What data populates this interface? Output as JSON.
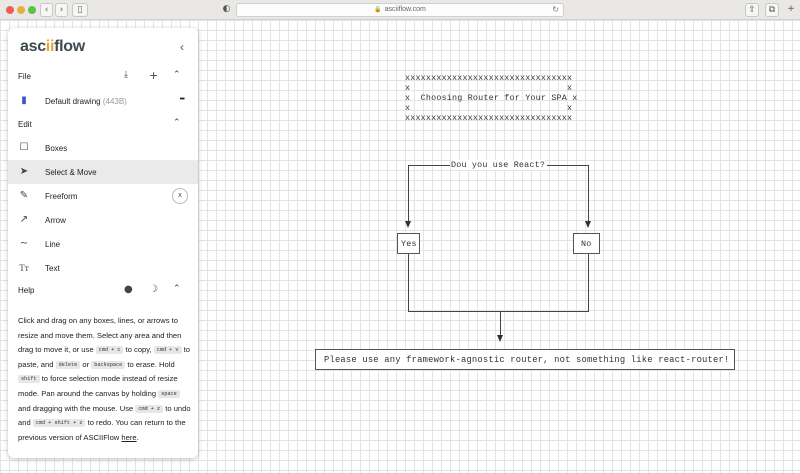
{
  "browser": {
    "url": "asciiflow.com",
    "back_icon": "chevron-left",
    "forward_icon": "chevron-right",
    "sidebar_icon": "sidebar",
    "privacy_icon": "half-circle",
    "reload_icon": "reload",
    "share_icon": "share",
    "tabs_icon": "tabs"
  },
  "sidebar": {
    "logo_prefix": "asc",
    "logo_accent": "ii",
    "logo_suffix": "flow",
    "collapse_icon": "chevron-left",
    "file": {
      "label": "File",
      "drawing_name": "Default drawing",
      "drawing_size": "(443B)",
      "more": "•••"
    },
    "edit": {
      "label": "Edit",
      "tools": [
        {
          "label": "Boxes",
          "icon": "square-icon"
        },
        {
          "label": "Select & Move",
          "icon": "cursor-icon",
          "selected": true
        },
        {
          "label": "Freeform",
          "icon": "pen-icon"
        },
        {
          "label": "Arrow",
          "icon": "arrow-icon"
        },
        {
          "label": "Line",
          "icon": "line-icon"
        },
        {
          "label": "Text",
          "icon": "text-icon"
        }
      ],
      "clear_label": "x",
      "text_icon_glyph": "Tт"
    },
    "help": {
      "label": "Help",
      "t1": "Click and drag on any boxes, lines, or arrows to resize and move them. Select any area and then drag to move it, or use ",
      "k_copy": "cmd + c",
      "t2": " to copy, ",
      "k_paste": "cmd + v",
      "t3": " to paste, and ",
      "k_delete": "delete",
      "t4": " or ",
      "k_backspace": "backspace",
      "t5": " to erase. Hold ",
      "k_shift": "shift",
      "t6": " to force selection mode instead of resize mode. Pan around the canvas by holding ",
      "k_space": "space",
      "t7": " and dragging with the mouse. Use ",
      "k_undo": "cmd + z",
      "t8": " to undo and ",
      "k_redo": "cmd + shift + z",
      "t9": " to redo. You can return to the previous version of ASCIIFlow ",
      "link": "here",
      "t10": "."
    }
  },
  "diagram": {
    "title_top": "xxxxxxxxxxxxxxxxxxxxxxxxxxxxxxxx",
    "title_side": "x                              x",
    "title_mid": "x  Choosing Router for Your SPA x",
    "question_line": "+----------Dou you use React?------------+",
    "question": "Dou you use React?",
    "yes": "Yes",
    "no": "No",
    "result": "Please use any framework-agnostic router, not something like react-router!"
  }
}
